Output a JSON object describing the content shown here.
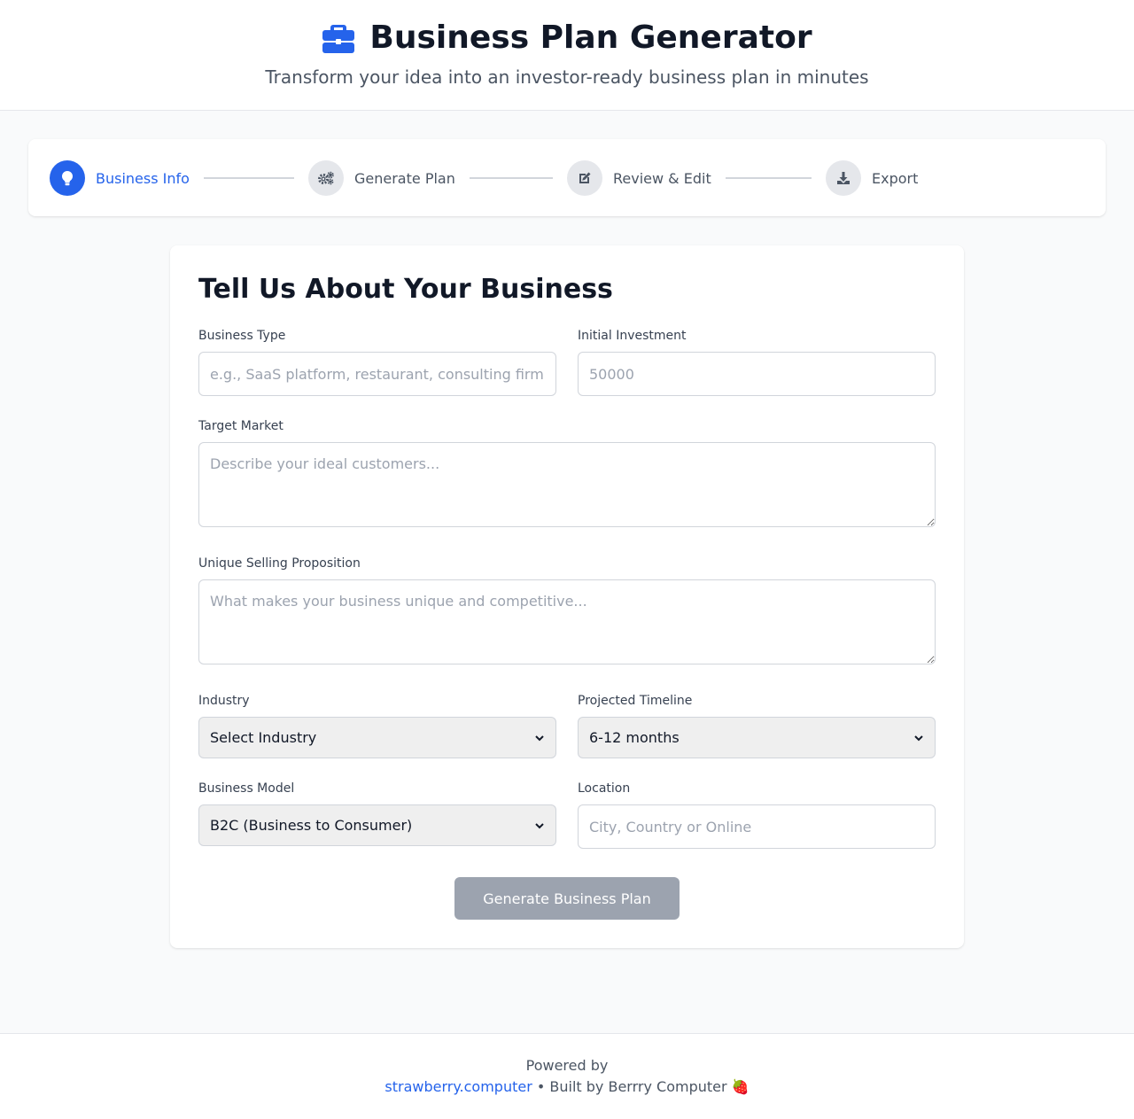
{
  "header": {
    "title": "Business Plan Generator",
    "subtitle": "Transform your idea into an investor-ready business plan in minutes",
    "icon": "briefcase-icon"
  },
  "steps": [
    {
      "label": "Business Info",
      "icon": "lightbulb-icon",
      "active": true
    },
    {
      "label": "Generate Plan",
      "icon": "gears-icon",
      "active": false
    },
    {
      "label": "Review & Edit",
      "icon": "edit-icon",
      "active": false
    },
    {
      "label": "Export",
      "icon": "download-icon",
      "active": false
    }
  ],
  "form": {
    "title": "Tell Us About Your Business",
    "business_type": {
      "label": "Business Type",
      "value": "",
      "placeholder": "e.g., SaaS platform, restaurant, consulting firm"
    },
    "initial_investment": {
      "label": "Initial Investment",
      "value": "",
      "placeholder": "50000"
    },
    "target_market": {
      "label": "Target Market",
      "value": "",
      "placeholder": "Describe your ideal customers..."
    },
    "usp": {
      "label": "Unique Selling Proposition",
      "value": "",
      "placeholder": "What makes your business unique and competitive..."
    },
    "industry": {
      "label": "Industry",
      "selected": "Select Industry"
    },
    "timeline": {
      "label": "Projected Timeline",
      "selected": "6-12 months"
    },
    "business_model": {
      "label": "Business Model",
      "selected": "B2C (Business to Consumer)"
    },
    "location": {
      "label": "Location",
      "value": "",
      "placeholder": "City, Country or Online"
    },
    "submit_label": "Generate Business Plan"
  },
  "footer": {
    "powered_by": "Powered by",
    "link_text": "strawberry.computer",
    "built_by": " • Built by Berrry Computer 🍓"
  },
  "colors": {
    "accent": "#2563eb",
    "disabled_button": "#9ca3af",
    "background": "#f9fafb"
  }
}
